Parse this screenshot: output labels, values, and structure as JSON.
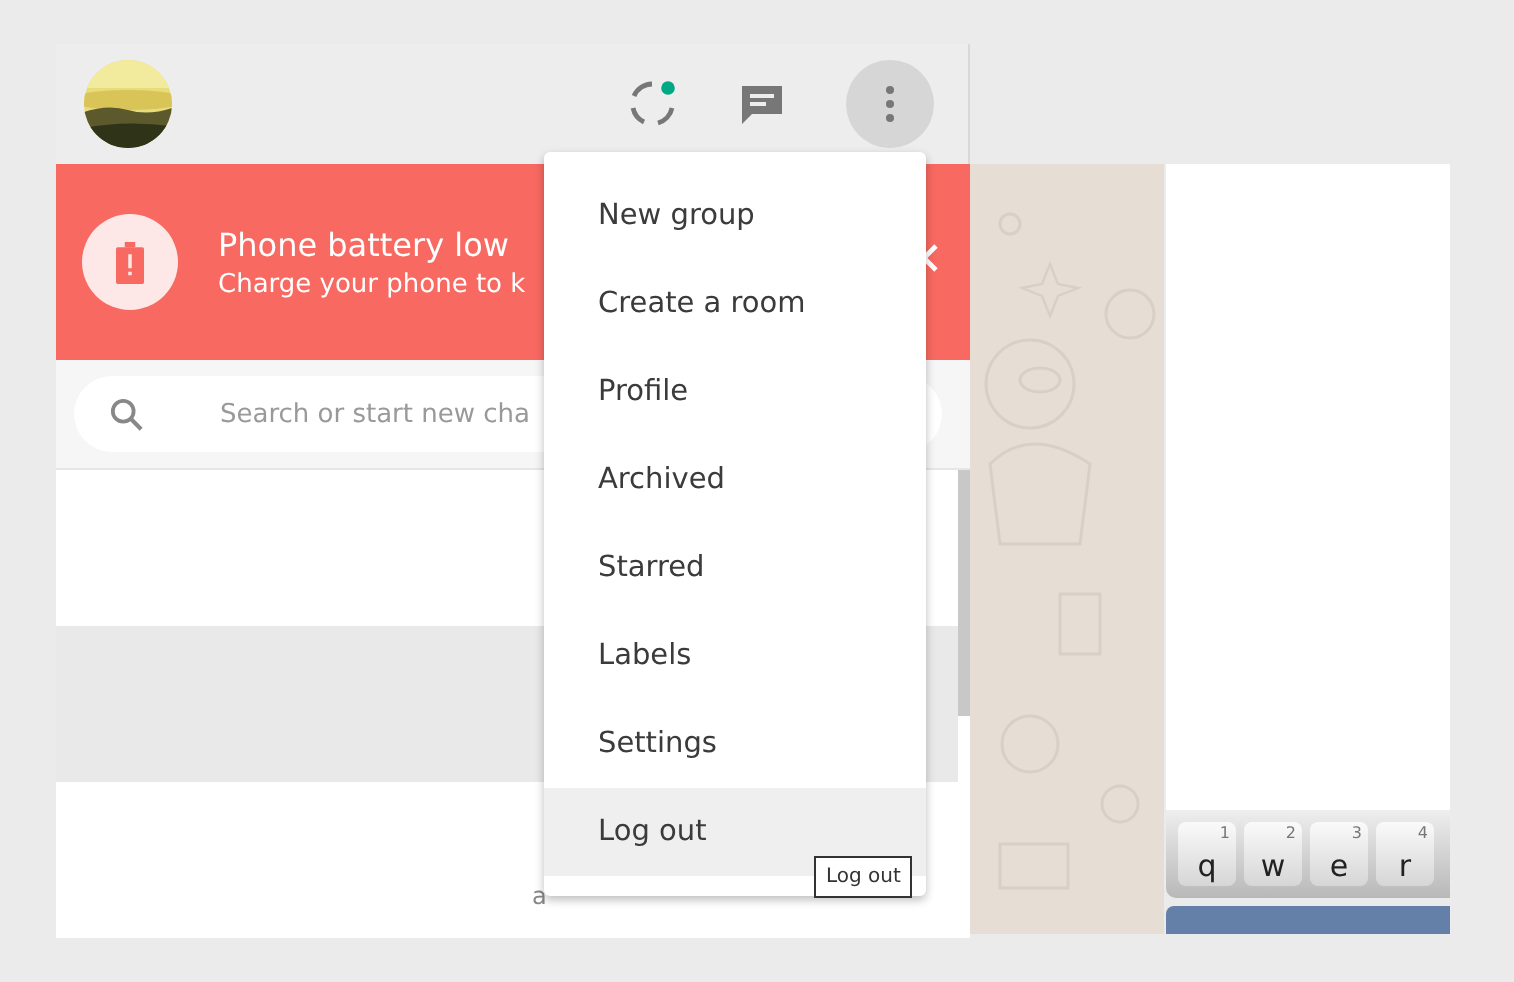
{
  "header": {
    "menu_open": true
  },
  "banner": {
    "title": "Phone battery low",
    "subtitle": "Charge your phone to k"
  },
  "search": {
    "placeholder": "Search or start new cha"
  },
  "chats": [
    {
      "selected": false
    },
    {
      "selected": true
    },
    {
      "selected": false,
      "preview": "a"
    }
  ],
  "menu": [
    {
      "label": "New group",
      "selected": false
    },
    {
      "label": "Create a room",
      "selected": false
    },
    {
      "label": "Profile",
      "selected": false
    },
    {
      "label": "Archived",
      "selected": false
    },
    {
      "label": "Starred",
      "selected": false
    },
    {
      "label": "Labels",
      "selected": false
    },
    {
      "label": "Settings",
      "selected": false
    },
    {
      "label": "Log out",
      "selected": true
    }
  ],
  "tooltip": "Log out",
  "keyboard": [
    {
      "key": "q",
      "hint": "1"
    },
    {
      "key": "w",
      "hint": "2"
    },
    {
      "key": "e",
      "hint": "3"
    },
    {
      "key": "r",
      "hint": "4"
    }
  ]
}
